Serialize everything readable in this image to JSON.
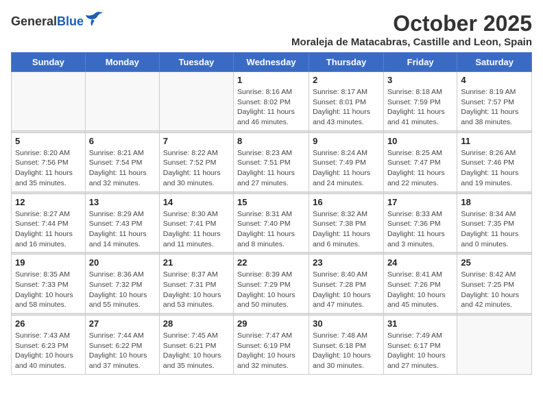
{
  "logo": {
    "general": "General",
    "blue": "Blue"
  },
  "title": "October 2025",
  "subtitle": "Moraleja de Matacabras, Castille and Leon, Spain",
  "weekdays": [
    "Sunday",
    "Monday",
    "Tuesday",
    "Wednesday",
    "Thursday",
    "Friday",
    "Saturday"
  ],
  "weeks": [
    [
      {
        "day": "",
        "info": ""
      },
      {
        "day": "",
        "info": ""
      },
      {
        "day": "",
        "info": ""
      },
      {
        "day": "1",
        "info": "Sunrise: 8:16 AM\nSunset: 8:02 PM\nDaylight: 11 hours and 46 minutes."
      },
      {
        "day": "2",
        "info": "Sunrise: 8:17 AM\nSunset: 8:01 PM\nDaylight: 11 hours and 43 minutes."
      },
      {
        "day": "3",
        "info": "Sunrise: 8:18 AM\nSunset: 7:59 PM\nDaylight: 11 hours and 41 minutes."
      },
      {
        "day": "4",
        "info": "Sunrise: 8:19 AM\nSunset: 7:57 PM\nDaylight: 11 hours and 38 minutes."
      }
    ],
    [
      {
        "day": "5",
        "info": "Sunrise: 8:20 AM\nSunset: 7:56 PM\nDaylight: 11 hours and 35 minutes."
      },
      {
        "day": "6",
        "info": "Sunrise: 8:21 AM\nSunset: 7:54 PM\nDaylight: 11 hours and 32 minutes."
      },
      {
        "day": "7",
        "info": "Sunrise: 8:22 AM\nSunset: 7:52 PM\nDaylight: 11 hours and 30 minutes."
      },
      {
        "day": "8",
        "info": "Sunrise: 8:23 AM\nSunset: 7:51 PM\nDaylight: 11 hours and 27 minutes."
      },
      {
        "day": "9",
        "info": "Sunrise: 8:24 AM\nSunset: 7:49 PM\nDaylight: 11 hours and 24 minutes."
      },
      {
        "day": "10",
        "info": "Sunrise: 8:25 AM\nSunset: 7:47 PM\nDaylight: 11 hours and 22 minutes."
      },
      {
        "day": "11",
        "info": "Sunrise: 8:26 AM\nSunset: 7:46 PM\nDaylight: 11 hours and 19 minutes."
      }
    ],
    [
      {
        "day": "12",
        "info": "Sunrise: 8:27 AM\nSunset: 7:44 PM\nDaylight: 11 hours and 16 minutes."
      },
      {
        "day": "13",
        "info": "Sunrise: 8:29 AM\nSunset: 7:43 PM\nDaylight: 11 hours and 14 minutes."
      },
      {
        "day": "14",
        "info": "Sunrise: 8:30 AM\nSunset: 7:41 PM\nDaylight: 11 hours and 11 minutes."
      },
      {
        "day": "15",
        "info": "Sunrise: 8:31 AM\nSunset: 7:40 PM\nDaylight: 11 hours and 8 minutes."
      },
      {
        "day": "16",
        "info": "Sunrise: 8:32 AM\nSunset: 7:38 PM\nDaylight: 11 hours and 6 minutes."
      },
      {
        "day": "17",
        "info": "Sunrise: 8:33 AM\nSunset: 7:36 PM\nDaylight: 11 hours and 3 minutes."
      },
      {
        "day": "18",
        "info": "Sunrise: 8:34 AM\nSunset: 7:35 PM\nDaylight: 11 hours and 0 minutes."
      }
    ],
    [
      {
        "day": "19",
        "info": "Sunrise: 8:35 AM\nSunset: 7:33 PM\nDaylight: 10 hours and 58 minutes."
      },
      {
        "day": "20",
        "info": "Sunrise: 8:36 AM\nSunset: 7:32 PM\nDaylight: 10 hours and 55 minutes."
      },
      {
        "day": "21",
        "info": "Sunrise: 8:37 AM\nSunset: 7:31 PM\nDaylight: 10 hours and 53 minutes."
      },
      {
        "day": "22",
        "info": "Sunrise: 8:39 AM\nSunset: 7:29 PM\nDaylight: 10 hours and 50 minutes."
      },
      {
        "day": "23",
        "info": "Sunrise: 8:40 AM\nSunset: 7:28 PM\nDaylight: 10 hours and 47 minutes."
      },
      {
        "day": "24",
        "info": "Sunrise: 8:41 AM\nSunset: 7:26 PM\nDaylight: 10 hours and 45 minutes."
      },
      {
        "day": "25",
        "info": "Sunrise: 8:42 AM\nSunset: 7:25 PM\nDaylight: 10 hours and 42 minutes."
      }
    ],
    [
      {
        "day": "26",
        "info": "Sunrise: 7:43 AM\nSunset: 6:23 PM\nDaylight: 10 hours and 40 minutes."
      },
      {
        "day": "27",
        "info": "Sunrise: 7:44 AM\nSunset: 6:22 PM\nDaylight: 10 hours and 37 minutes."
      },
      {
        "day": "28",
        "info": "Sunrise: 7:45 AM\nSunset: 6:21 PM\nDaylight: 10 hours and 35 minutes."
      },
      {
        "day": "29",
        "info": "Sunrise: 7:47 AM\nSunset: 6:19 PM\nDaylight: 10 hours and 32 minutes."
      },
      {
        "day": "30",
        "info": "Sunrise: 7:48 AM\nSunset: 6:18 PM\nDaylight: 10 hours and 30 minutes."
      },
      {
        "day": "31",
        "info": "Sunrise: 7:49 AM\nSunset: 6:17 PM\nDaylight: 10 hours and 27 minutes."
      },
      {
        "day": "",
        "info": ""
      }
    ]
  ]
}
